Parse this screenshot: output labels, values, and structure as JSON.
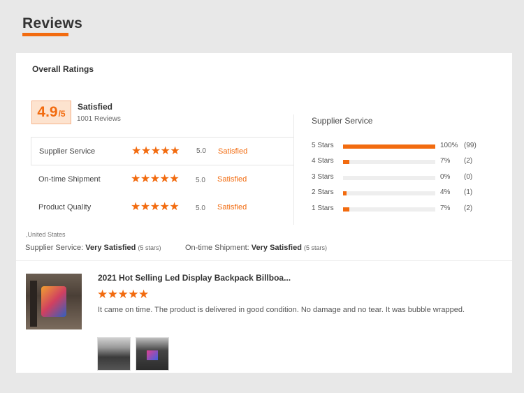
{
  "header": {
    "title": "Reviews"
  },
  "overall": {
    "title": "Overall Ratings",
    "score": "4.9",
    "score_suffix": "/5",
    "status": "Satisfied",
    "reviews": "1001 Reviews"
  },
  "metrics": [
    {
      "label": "Supplier Service",
      "stars": "★★★★★",
      "score": "5.0",
      "status": "Satisfied"
    },
    {
      "label": "On-time Shipment",
      "stars": "★★★★★",
      "score": "5.0",
      "status": "Satisfied"
    },
    {
      "label": "Product Quality",
      "stars": "★★★★★",
      "score": "5.0",
      "status": "Satisfied"
    }
  ],
  "supplier_service": {
    "title": "Supplier Service",
    "rows": [
      {
        "label": "5 Stars",
        "fraction": 1.0,
        "pct": "100%",
        "count": "(99)"
      },
      {
        "label": "4 Stars",
        "fraction": 0.07,
        "pct": "7%",
        "count": "(2)"
      },
      {
        "label": "3 Stars",
        "fraction": 0.0,
        "pct": "0%",
        "count": "(0)"
      },
      {
        "label": "2 Stars",
        "fraction": 0.04,
        "pct": "4%",
        "count": "(1)"
      },
      {
        "label": "1 Stars",
        "fraction": 0.07,
        "pct": "7%",
        "count": "(2)"
      }
    ]
  },
  "review": {
    "location": ",United States",
    "supplier_label": "Supplier Service:",
    "supplier_value": "Very Satisfied",
    "supplier_stars": "(5 stars)",
    "shipment_label": "On-time Shipment:",
    "shipment_value": "Very Satisfied",
    "shipment_stars": "(5 stars)",
    "product_title": "2021 Hot Selling Led Display Backpack Billboa...",
    "stars": "★★★★★",
    "text": "It came on time. The product is delivered in good condition. No damage and no tear. It was bubble wrapped."
  },
  "colors": {
    "accent": "#f26b0f"
  }
}
